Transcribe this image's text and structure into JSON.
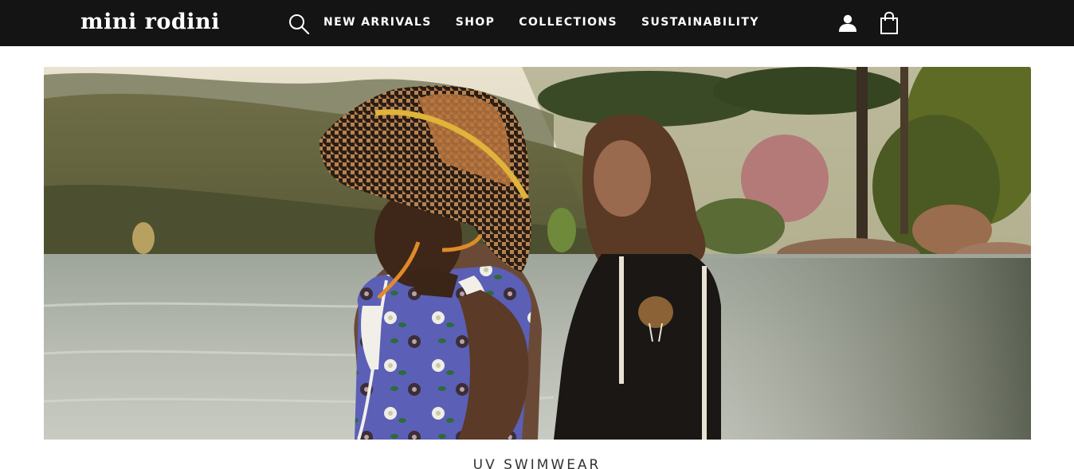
{
  "header": {
    "logo_text": "mini rodini",
    "search_icon": "search-icon",
    "nav": [
      {
        "label": "NEW ARRIVALS"
      },
      {
        "label": "SHOP"
      },
      {
        "label": "COLLECTIONS"
      },
      {
        "label": "SUSTAINABILITY"
      }
    ],
    "account_icon": "user-icon",
    "bag_icon": "shopping-bag-icon"
  },
  "hero": {
    "image_description": "Two children standing by a lake in a green landscape, one wearing a houndstooth bucket hat and floral swimsuit, the other a black swim jacket with an elephant print",
    "caption": "UV SWIMWEAR"
  },
  "colors": {
    "header_bg": "#141414",
    "header_text": "#ffffff",
    "page_bg": "#ffffff",
    "caption_text": "#333333"
  }
}
